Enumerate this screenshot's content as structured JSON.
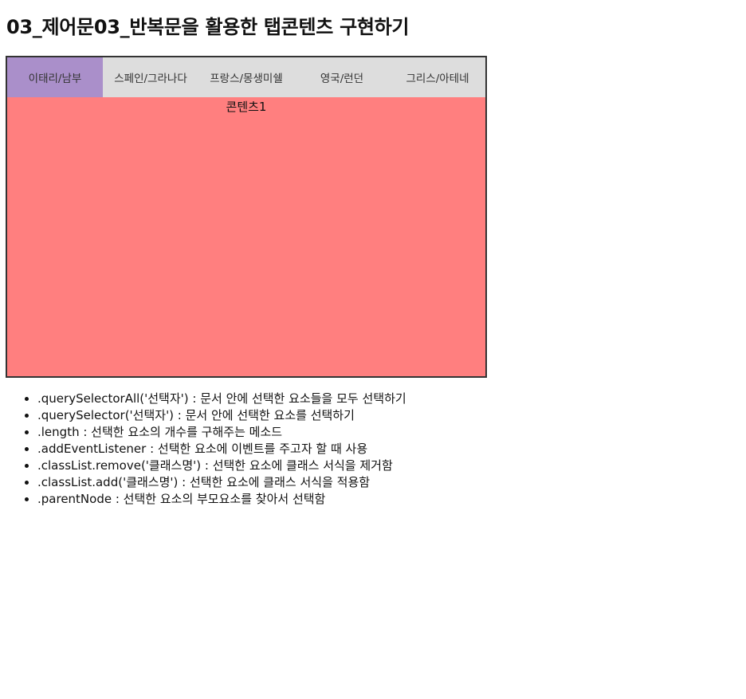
{
  "page": {
    "title": "03_제어문03_반복문을 활용한 탭콘텐츠 구현하기"
  },
  "tabs": [
    {
      "label": "이태리/남부",
      "active": true
    },
    {
      "label": "스페인/그라나다",
      "active": false
    },
    {
      "label": "프랑스/몽생미쉘",
      "active": false
    },
    {
      "label": "영국/런던",
      "active": false
    },
    {
      "label": "그리스/아테네",
      "active": false
    }
  ],
  "panel": {
    "content": "콘텐츠1"
  },
  "colors": {
    "tab_bar_bg": "#dddddd",
    "active_tab_bg": "#aa8fca",
    "panel_bg": "#ff7f7f",
    "border": "#333333"
  },
  "notes": [
    ".querySelectorAll('선택자') : 문서 안에 선택한 요소들을 모두 선택하기",
    ".querySelector('선택자') : 문서 안에 선택한 요소를 선택하기",
    ".length : 선택한 요소의 개수를 구해주는 메소드",
    ".addEventListener : 선택한 요소에 이벤트를 주고자 할 때 사용",
    ".classList.remove('클래스명') : 선택한 요소에 클래스 서식을 제거함",
    ".classList.add('클래스명') : 선택한 요소에 클래스 서식을 적용함",
    ".parentNode : 선택한 요소의 부모요소를 찾아서 선택함"
  ]
}
